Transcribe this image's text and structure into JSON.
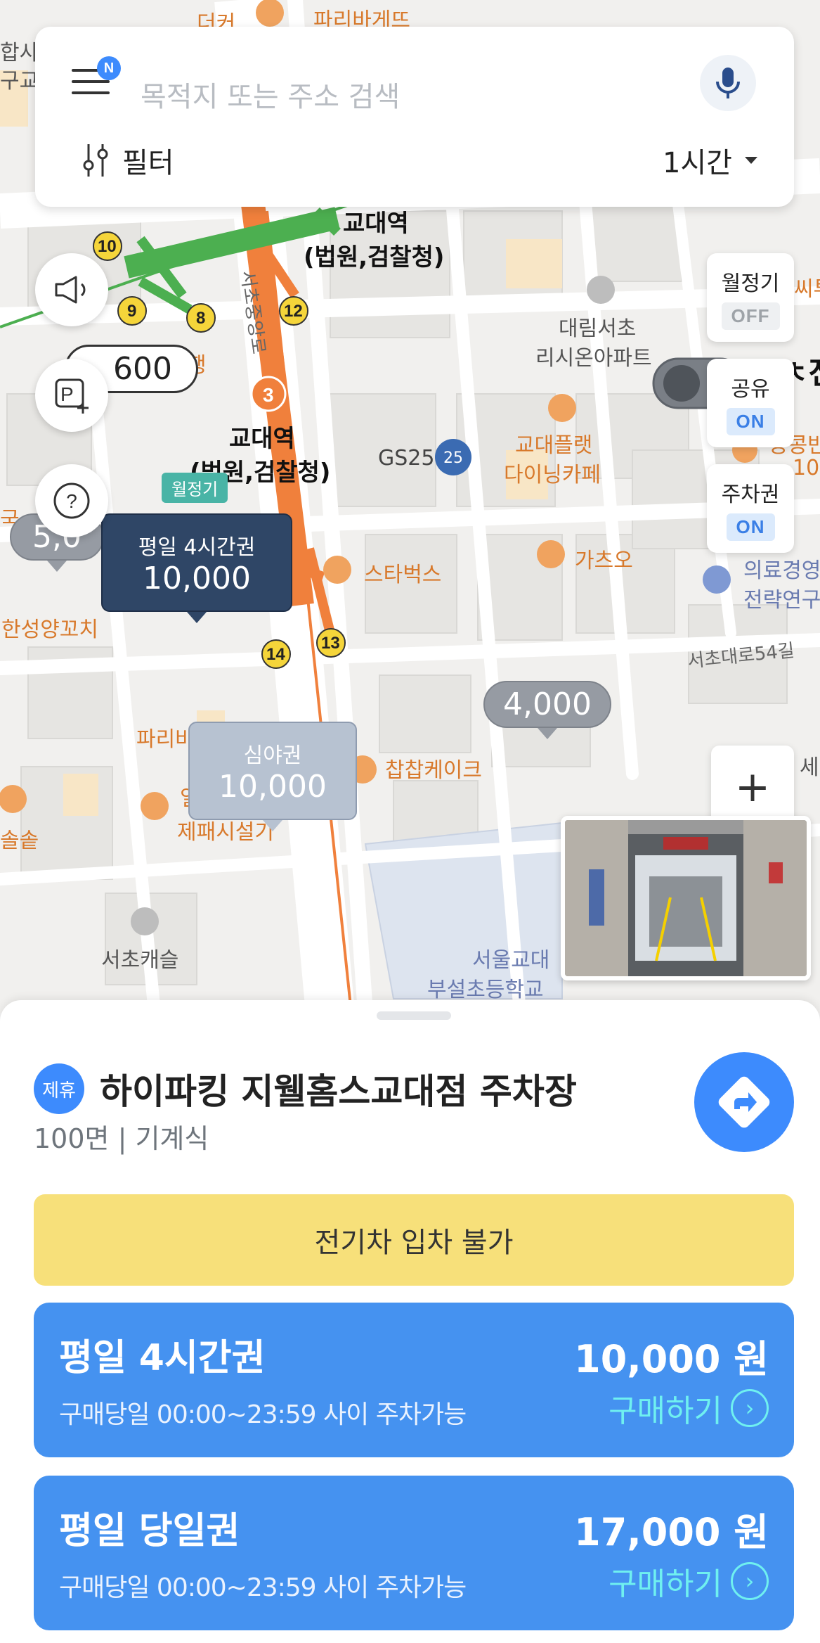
{
  "search": {
    "placeholder": "목적지 또는 주소 검색",
    "menu_badge": "N",
    "filter_label": "필터",
    "duration": "1시간"
  },
  "toggles": [
    {
      "label": "월정기",
      "state": "OFF"
    },
    {
      "label": "공유",
      "state": "ON"
    },
    {
      "label": "주차권",
      "state": "ON"
    }
  ],
  "map": {
    "labels": {
      "station_top": "교대역",
      "station_top_sub": "(법원,검찰청)",
      "station_mid": "교대역",
      "station_mid_sub": "(법원,검찰청)",
      "road_vertical": "서초중앙로",
      "daerim": "대림서초",
      "daerim_sub": "리시온아파트",
      "gs25": "GS25",
      "gyodae_flat": "교대플랫",
      "gyodae_flat_sub": "다이닝카페",
      "starbucks": "스타벅스",
      "gacho": "가츠오",
      "medical": "의료경영",
      "medical_sub": "전략연구",
      "seocho_road": "서초대로54길",
      "hansung": "한성양꼬치",
      "chapchap": "찹찹케이크",
      "seocho_castle": "서초캐슬",
      "school": "서울교대",
      "school_sub": "부설초등학교",
      "paris_top": "파리바게뜨",
      "paris_mid": "파리바",
      "top_left": "합사",
      "top_left_sub": "구교",
      "hoyu_frag": "씨투",
      "top_frag": "더커",
      "jung_frag": "중콩반",
      "jung_frag_sub": "10",
      "le_frag": "세",
      "left_frag1": "국",
      "left_frag2": "솔솥",
      "sebi": "제패시설기",
      "eul": "일",
      "bank_frag": "행",
      "jeon_frag": "ㅊ전"
    },
    "exits": [
      "10",
      "9",
      "8",
      "12",
      "3",
      "14",
      "13"
    ],
    "monthly_tag": "월정기"
  },
  "markers": [
    {
      "sub": "평일 4시간권",
      "price": "10,000"
    },
    {
      "sub": "심야권",
      "price": "10,000"
    },
    {
      "price": "4,000"
    },
    {
      "price": "600"
    },
    {
      "price": "5,0"
    }
  ],
  "zoom_in_label": "+",
  "sheet": {
    "partner_badge": "제휴",
    "lot_name": "하이파킹 지웰홈스교대점 주차장",
    "lot_info": "100면 | 기계식",
    "ev_notice": "전기차 입차 불가",
    "tickets": [
      {
        "name": "평일 4시간권",
        "desc": "구매당일 00:00~23:59 사이 주차가능",
        "price": "10,000 원",
        "buy": "구매하기"
      },
      {
        "name": "평일 당일권",
        "desc": "구매당일 00:00~23:59 사이 주차가능",
        "price": "17,000 원",
        "buy": "구매하기"
      }
    ]
  },
  "colors": {
    "accent": "#3d8bfd",
    "ticket": "#4592f0",
    "ev_banner": "#f7e07a",
    "subway_line3": "#f0803c",
    "subway_line2": "#4caf50",
    "marker_dark": "#2f4666"
  }
}
